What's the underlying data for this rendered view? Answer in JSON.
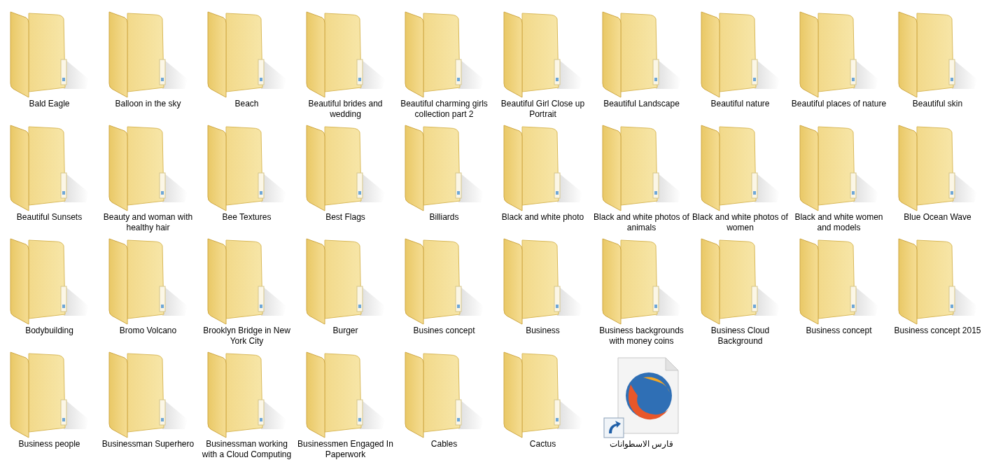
{
  "items": [
    {
      "kind": "folder",
      "label": "Bald Eagle"
    },
    {
      "kind": "folder",
      "label": "Balloon in the sky"
    },
    {
      "kind": "folder",
      "label": "Beach"
    },
    {
      "kind": "folder",
      "label": "Beautiful brides and wedding"
    },
    {
      "kind": "folder",
      "label": "Beautiful charming girls collection part 2"
    },
    {
      "kind": "folder",
      "label": "Beautiful Girl Close up Portrait"
    },
    {
      "kind": "folder",
      "label": "Beautiful Landscape"
    },
    {
      "kind": "folder",
      "label": "Beautiful nature"
    },
    {
      "kind": "folder",
      "label": "Beautiful places of nature"
    },
    {
      "kind": "folder",
      "label": "Beautiful skin"
    },
    {
      "kind": "folder",
      "label": "Beautiful Sunsets"
    },
    {
      "kind": "folder",
      "label": "Beauty and woman with healthy hair"
    },
    {
      "kind": "folder",
      "label": "Bee Textures"
    },
    {
      "kind": "folder",
      "label": "Best Flags"
    },
    {
      "kind": "folder",
      "label": "Billiards"
    },
    {
      "kind": "folder",
      "label": "Black and white photo"
    },
    {
      "kind": "folder",
      "label": "Black and white photos of animals"
    },
    {
      "kind": "folder",
      "label": "Black and white photos of women"
    },
    {
      "kind": "folder",
      "label": "Black and white women and models"
    },
    {
      "kind": "folder",
      "label": "Blue Ocean Wave"
    },
    {
      "kind": "folder",
      "label": "Bodybuilding"
    },
    {
      "kind": "folder",
      "label": "Bromo Volcano"
    },
    {
      "kind": "folder",
      "label": "Brooklyn Bridge in New York City"
    },
    {
      "kind": "folder",
      "label": "Burger"
    },
    {
      "kind": "folder",
      "label": "Busines concept"
    },
    {
      "kind": "folder",
      "label": "Business"
    },
    {
      "kind": "folder",
      "label": "Business backgrounds with money coins"
    },
    {
      "kind": "folder",
      "label": "Business Cloud Background"
    },
    {
      "kind": "folder",
      "label": "Business concept"
    },
    {
      "kind": "folder",
      "label": "Business concept 2015"
    },
    {
      "kind": "folder",
      "label": "Business people"
    },
    {
      "kind": "folder",
      "label": "Businessman Superhero"
    },
    {
      "kind": "folder",
      "label": "Businessman working with a Cloud Computing"
    },
    {
      "kind": "folder",
      "label": "Businessmen Engaged In Paperwork"
    },
    {
      "kind": "folder",
      "label": "Cables"
    },
    {
      "kind": "folder",
      "label": "Cactus"
    },
    {
      "kind": "shortcut",
      "label": "قارس الاسطوانات"
    }
  ]
}
